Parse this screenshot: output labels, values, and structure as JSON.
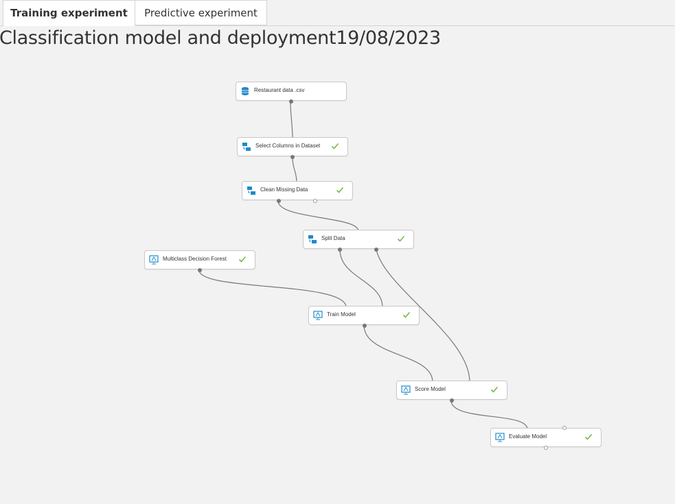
{
  "tabs": [
    {
      "label": "Training experiment",
      "active": true
    },
    {
      "label": "Predictive experiment",
      "active": false
    }
  ],
  "experiment_title": "Classification model and deployment19/08/2023",
  "modules": {
    "restaurant_data": {
      "label": "Restaurant data .csv",
      "icon": "dataset-icon",
      "status": "none"
    },
    "select_columns": {
      "label": "Select Columns in Dataset",
      "icon": "data-transform-icon",
      "status": "success"
    },
    "clean_missing": {
      "label": "Clean Missing Data",
      "icon": "data-transform-icon",
      "status": "success"
    },
    "split_data": {
      "label": "Split Data",
      "icon": "data-transform-icon",
      "status": "success"
    },
    "multiclass_forest": {
      "label": "Multiclass Decision Forest",
      "icon": "ml-model-icon",
      "status": "success"
    },
    "train_model": {
      "label": "Train Model",
      "icon": "ml-model-icon",
      "status": "success"
    },
    "score_model": {
      "label": "Score Model",
      "icon": "ml-model-icon",
      "status": "success"
    },
    "evaluate_model": {
      "label": "Evaluate Model",
      "icon": "ml-model-icon",
      "status": "success"
    }
  },
  "colors": {
    "accent_icon": "#1f8ac9",
    "check": "#7ab648",
    "connector": "#777777"
  }
}
